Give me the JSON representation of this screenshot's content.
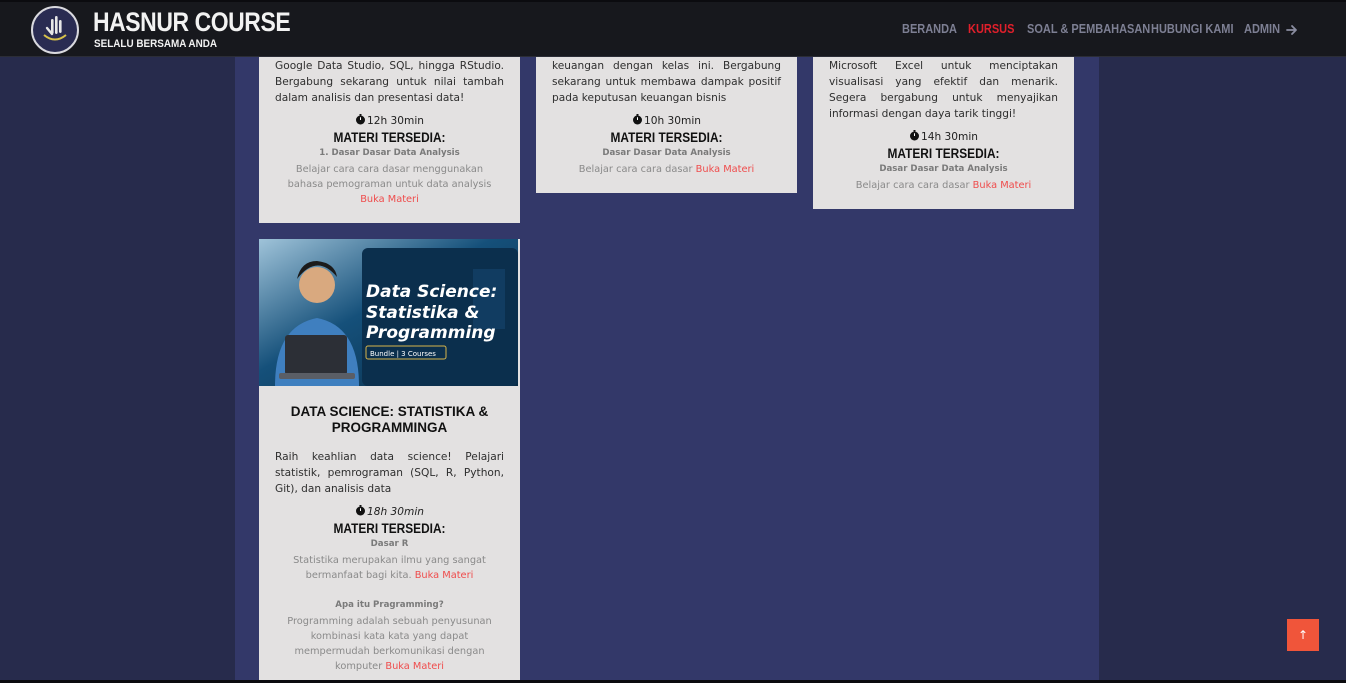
{
  "header": {
    "brand_title": "HASNUR COURSE",
    "brand_subtitle": "SELALU BERSAMA ANDA",
    "logo_icon": "hand-emblem-icon",
    "nav": [
      {
        "label": "BERANDA",
        "active": false
      },
      {
        "label": "KURSUS",
        "active": true
      },
      {
        "label": "SOAL & PEMBAHASAN",
        "active": false
      },
      {
        "label": "HUBUNGI KAMI",
        "active": false
      },
      {
        "label": "ADMIN",
        "active": false,
        "icon": "arrow-right-icon"
      }
    ]
  },
  "colors": {
    "page_bg": "#272b4c",
    "main_col_bg": "#333869",
    "card_bg": "#e3e1e1",
    "nav_active": "#e01f2b",
    "link": "#ef4c4c",
    "scroll_button": "#f0553a"
  },
  "cards": [
    {
      "description_lines": [
        "Google Data Studio, SQL, hingga RStudio.",
        "Bergabung sekarang untuk nilai tambah",
        "dalam analisis dan presentasi data!"
      ],
      "duration": "12h 30min",
      "materi_heading": "MATERI TERSEDIA:",
      "lessons": [
        {
          "title": "1. Dasar Dasar Data Analysis",
          "desc_lines": [
            "Belajar cara cara dasar menggunakan",
            "bahasa pemograman untuk data analysis"
          ],
          "link": "Buka Materi"
        }
      ]
    },
    {
      "description_lines": [
        "keuangan dengan kelas ini. Bergabung",
        "sekarang untuk membawa dampak positif",
        "pada keputusan keuangan bisnis"
      ],
      "duration": "10h 30min",
      "materi_heading": "MATERI TERSEDIA:",
      "lessons": [
        {
          "title": "Dasar Dasar Data Analysis",
          "desc_lines": [
            "Belajar cara cara dasar"
          ],
          "link": "Buka Materi"
        }
      ]
    },
    {
      "description_lines": [
        "Microsoft Excel untuk menciptakan",
        "visualisasi yang efektif dan menarik.",
        "Segera bergabung untuk menyajikan",
        "informasi dengan daya tarik tinggi!"
      ],
      "duration": "14h 30min",
      "materi_heading": "MATERI TERSEDIA:",
      "lessons": [
        {
          "title": "Dasar Dasar Data Analysis",
          "desc_lines": [
            "Belajar cara cara dasar"
          ],
          "link": "Buka Materi"
        }
      ]
    },
    {
      "image": {
        "title_line1": "Data Science:",
        "title_line2": "Statistika &",
        "title_line3": "Programming",
        "badge": "Bundle | 3 Courses"
      },
      "title": "DATA SCIENCE: STATISTIKA & PROGRAMMINGA",
      "description_lines": [
        "Raih keahlian data science! Pelajari",
        "statistik, pemrograman (SQL, R, Python,",
        "Git), dan analisis data"
      ],
      "duration": "18h 30min",
      "materi_heading": "MATERI TERSEDIA:",
      "lessons": [
        {
          "title": "Dasar R",
          "desc_lines": [
            "Statistika merupakan ilmu yang sangat",
            "bermanfaat bagi kita."
          ],
          "link": "Buka Materi"
        },
        {
          "title": "Apa itu Pragramming?",
          "desc_lines": [
            "Programming adalah sebuah penyusunan",
            "kombinasi kata kata yang dapat",
            "mempermudah berkomunikasi dengan",
            "komputer"
          ],
          "link": "Buka Materi"
        }
      ]
    }
  ],
  "scroll_top": {
    "icon": "arrow-up-icon",
    "glyph": "↑"
  }
}
